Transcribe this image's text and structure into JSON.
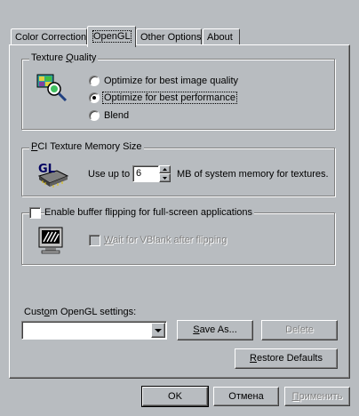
{
  "tabs": [
    {
      "label": "Color Correction",
      "active": false
    },
    {
      "label": "OpenGL",
      "active": true
    },
    {
      "label": "Other Options",
      "active": false
    },
    {
      "label": "About",
      "active": false
    }
  ],
  "texture_quality": {
    "title_prefix": "Texture ",
    "title_mnemonic": "Q",
    "title_suffix": "uality",
    "options": [
      {
        "label": "Optimize for best image quality",
        "checked": false
      },
      {
        "label": "Optimize for best performance",
        "checked": true
      },
      {
        "label": "Blend",
        "checked": false
      }
    ]
  },
  "pci_memory": {
    "title_mnemonic": "P",
    "title_suffix": "CI Texture Memory Size",
    "prefix": "Use up to",
    "value": "6",
    "suffix": "MB of system memory for textures."
  },
  "buffer_flip": {
    "label": "Enable buffer flipping for full-screen applications",
    "checked": false,
    "vblank_mnemonic": "W",
    "vblank_suffix": "ait for VBlank after flipping",
    "vblank_checked": false
  },
  "custom_settings": {
    "label_prefix": "Cust",
    "label_mnemonic": "o",
    "label_suffix": "m OpenGL settings:",
    "value": "",
    "save_mnemonic": "S",
    "save_suffix": "ave As...",
    "delete_label": "Delete",
    "restore_mnemonic": "R",
    "restore_suffix": "estore Defaults"
  },
  "dialog_buttons": {
    "ok": "OK",
    "cancel": "Отмена",
    "apply_mnemonic": "П",
    "apply_suffix": "рименить"
  },
  "icons": {
    "texture": "magnifier-texture-icon",
    "memory": "gl-memory-chip-icon",
    "monitor": "monitor-icon",
    "dropdown": "chevron-down-icon",
    "spin_up": "spin-up-icon",
    "spin_down": "spin-down-icon"
  }
}
